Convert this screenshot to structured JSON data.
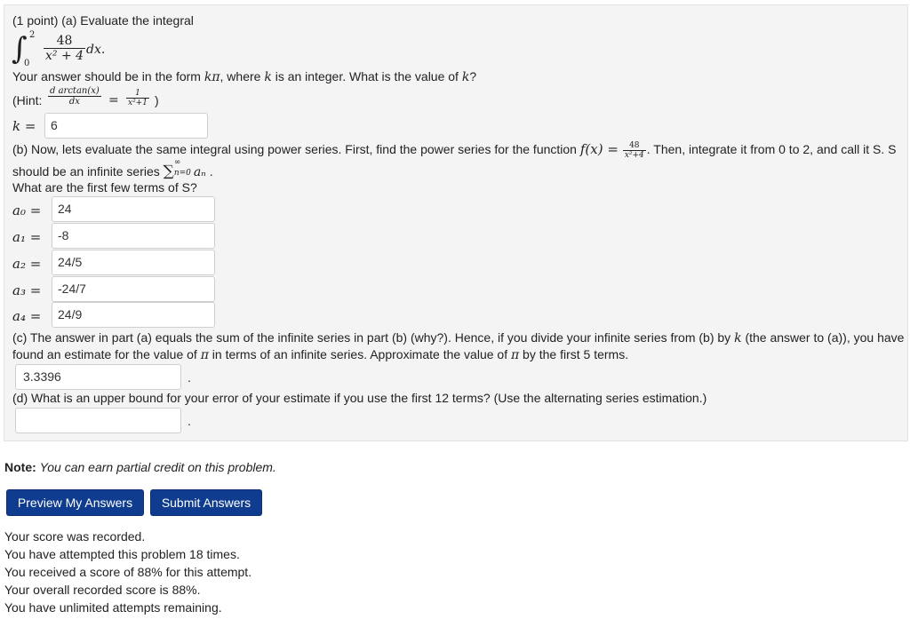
{
  "part_a": {
    "intro": "(1 point) (a) Evaluate the integral",
    "integral_upper": "2",
    "integral_lower": "0",
    "numerator": "48",
    "denominator": "x² + 4",
    "differential": "dx.",
    "form_text_1": "Your answer should be in the form ",
    "form_math": "kπ",
    "form_text_2": ", where ",
    "form_k": "k",
    "form_text_3": " is an integer. What is the value of ",
    "form_k2": "k",
    "form_text_4": "?",
    "hint_prefix": "(Hint: ",
    "hint_num": "d arctan(x)",
    "hint_den": "dx",
    "hint_eq": "=",
    "hint_rnum": "1",
    "hint_rden": "x²+1",
    "hint_suffix": ")",
    "k_label": "k",
    "k_value": "6"
  },
  "part_b": {
    "text_1": "(b) Now, lets evaluate the same integral using power series. First, find the power series for the function ",
    "f_math": "f(x) =",
    "f_num": "48",
    "f_den": "x²+4",
    "text_2": ". Then, integrate it from 0 to 2, and call it S. S",
    "text_3": "should be an infinite series ",
    "sum_sub": "n=0",
    "sum_sup": "∞",
    "sum_term": "aₙ",
    "text_4": " .",
    "question": "What are the first few terms of S?",
    "terms": [
      {
        "label": "a₀",
        "value": "24"
      },
      {
        "label": "a₁",
        "value": "-8"
      },
      {
        "label": "a₂",
        "value": "24/5"
      },
      {
        "label": "a₃",
        "value": "-24/7"
      },
      {
        "label": "a₄",
        "value": "24/9"
      }
    ]
  },
  "part_c": {
    "line1_a": "(c) The answer in part (a) equals the sum of the infinite series in part (b) (why?). Hence, if you divide your infinite series from (b) by ",
    "line1_k": "k",
    "line1_b": " (the answer to (a)), you have",
    "line2_a": "found an estimate for the value of ",
    "line2_pi": "π",
    "line2_b": " in terms of an infinite series. Approximate the value of ",
    "line2_pi2": "π",
    "line2_c": " by the first 5 terms.",
    "answer": "3.3396",
    "dot": "."
  },
  "part_d": {
    "text": "(d) What is an upper bound for your error of your estimate if you use the first 12 terms? (Use the alternating series estimation.)",
    "answer": "",
    "dot": "."
  },
  "note": {
    "label": "Note:",
    "text": "You can earn partial credit on this problem."
  },
  "buttons": {
    "preview": "Preview My Answers",
    "submit": "Submit Answers"
  },
  "status": [
    "Your score was recorded.",
    "You have attempted this problem 18 times.",
    "You received a score of 88% for this attempt.",
    "Your overall recorded score is 88%.",
    "You have unlimited attempts remaining."
  ]
}
